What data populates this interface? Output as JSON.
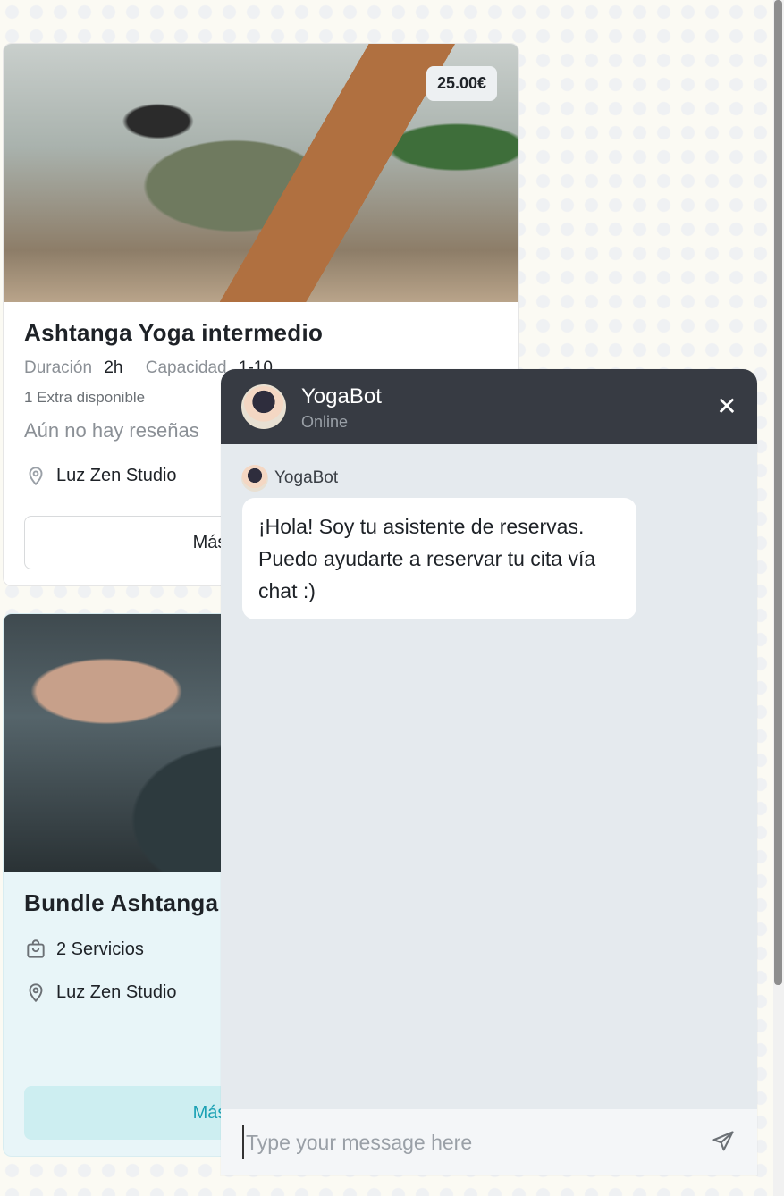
{
  "cards": [
    {
      "price": "25.00€",
      "title": "Ashtanga Yoga intermedio",
      "duration_label": "Duración",
      "duration_value": "2h",
      "capacity_label": "Capacidad",
      "capacity_value": "1-10",
      "extra": "1 Extra disponible",
      "reviews": "Aún no hay reseñas",
      "location": "Luz Zen Studio",
      "button": "Más información"
    },
    {
      "title": "Bundle Ashtanga",
      "services": "2 Servicios",
      "location": "Luz Zen Studio",
      "button": "Más información"
    }
  ],
  "chat": {
    "bot_name": "YogaBot",
    "status": "Online",
    "sender": "YogaBot",
    "message": "¡Hola! Soy tu asistente de reservas. Puedo ayudarte a reservar tu cita vía chat :)",
    "input_placeholder": "Type your message here"
  },
  "icons": {
    "close": "close-icon",
    "send": "send-icon",
    "location": "map-pin-icon",
    "bag": "shopping-bag-icon"
  },
  "colors": {
    "chat_header": "#373b43",
    "chat_body": "#e5eaee",
    "accent": "#1aa1b4"
  }
}
